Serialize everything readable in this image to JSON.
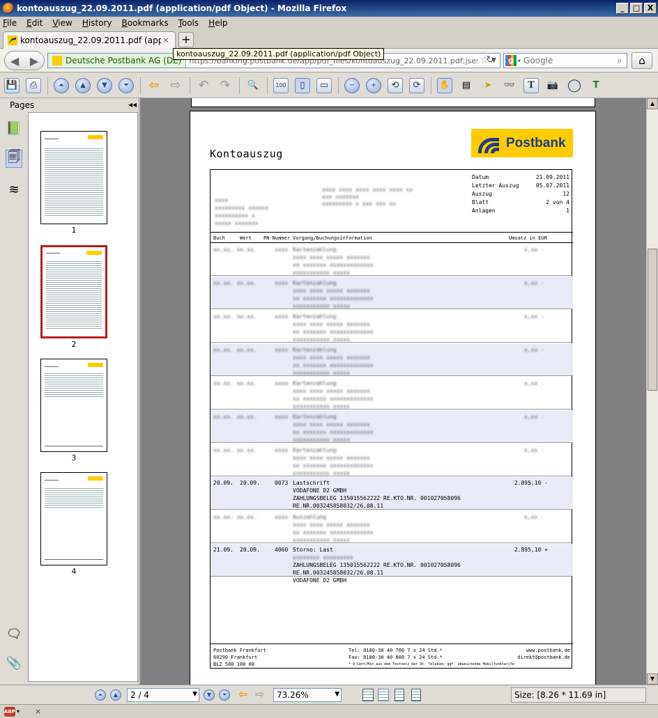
{
  "window": {
    "title": "kontoauszug_22.09.2011.pdf (application/pdf Object) - Mozilla Firefox",
    "minimize": "_",
    "maximize": "□",
    "close": "X"
  },
  "menu": [
    "File",
    "Edit",
    "View",
    "History",
    "Bookmarks",
    "Tools",
    "Help"
  ],
  "tab": {
    "label": "kontoauszug_22.09.2011.pdf (application/p...",
    "close": "×",
    "new_tab": "+"
  },
  "tooltip": "kontoauszug_22.09.2011.pdf (application/pdf Object)",
  "nav": {
    "identity": "Deutsche Postbank AG (DE)",
    "url": "https://banking.postbank.de/app/pdf_files/kontoauszug_22.09.2011.pdf;jsessionid=9",
    "search_placeholder": "Google"
  },
  "pages_panel": {
    "title": "Pages",
    "collapse": "◂◂",
    "thumbnails": [
      "1",
      "2",
      "3",
      "4"
    ],
    "selected": "2"
  },
  "document": {
    "title": "Kontoauszug",
    "brand": "Postbank",
    "info": [
      {
        "label": "Datum",
        "value": "21.09.2011"
      },
      {
        "label": "Letzter Auszug",
        "value": "05.07.2011"
      },
      {
        "label": "Auszug",
        "value": "12"
      },
      {
        "label": "Blatt",
        "value": "2 von 4"
      },
      {
        "label": "Anlagen",
        "value": "1"
      }
    ],
    "columns": {
      "buch": "Buch",
      "wert": "Wert",
      "pn": "PN-Nummer",
      "vorgang": "Vorgang/Buchungsinformation",
      "umsatz": "Umsatz in EUR"
    },
    "transactions": [
      {
        "visible": false,
        "shaded": false,
        "lines": [
          "Kartenzahlung"
        ]
      },
      {
        "visible": false,
        "shaded": true,
        "lines": [
          "Kartenzahlung"
        ]
      },
      {
        "visible": false,
        "shaded": false,
        "lines": [
          "Kartenzahlung"
        ]
      },
      {
        "visible": false,
        "shaded": true,
        "lines": [
          "Kartenzahlung"
        ]
      },
      {
        "visible": false,
        "shaded": false,
        "lines": [
          "Kartenzahlung"
        ]
      },
      {
        "visible": false,
        "shaded": true,
        "lines": [
          "Kartenzahlung"
        ]
      },
      {
        "visible": false,
        "shaded": false,
        "lines": [
          "Kartenzahlung"
        ]
      },
      {
        "visible": true,
        "shaded": true,
        "buch": "20.09.",
        "wert": "20.09.",
        "pn": "0073",
        "lines": [
          "Lastschrift",
          "VODAFONE D2 GMBH",
          "ZAHLUNGSBELEG 135015562222  RE.KTO.NR. 001027058096",
          "RE.NR.003245858032/26.08.11"
        ],
        "amount": "2.895,10 -"
      },
      {
        "visible": false,
        "shaded": false,
        "lines": [
          "Auszahlung"
        ]
      },
      {
        "visible": true,
        "shaded": true,
        "buch": "21.09.",
        "wert": "20.09.",
        "pn": "4060",
        "lines": [
          "Storno: Last",
          "",
          "ZAHLUNGSBELEG 135015562222  RE.KTO.NR. 001027058096",
          "RE.NR.003245858032/26.08.11",
          "VODAFONE D2 GMBH"
        ],
        "amount": "2.895,10 +"
      }
    ],
    "footer": {
      "branch": [
        "Postbank Frankfurt",
        "60290 Frankfurt",
        "BLZ 500 100 60"
      ],
      "contact": [
        "Tel: 0180-30 40 700 7 x 24 Std.*",
        "Fax: 0180-30 40 800 7 x 24 Std.*"
      ],
      "web": [
        "www.postbank.de",
        "direkt@postbank.de"
      ],
      "note": "* 9 Cent/Min aus dem Festnetz der Dt. Telekom; ggf. abweichende Mobilfunktarife"
    }
  },
  "status": {
    "page": "2 / 4",
    "zoom": "73.26%",
    "size": "Size: [8.26 * 11.69 in]"
  },
  "ffstatus": {
    "abp": "ABP",
    "close": "×"
  }
}
